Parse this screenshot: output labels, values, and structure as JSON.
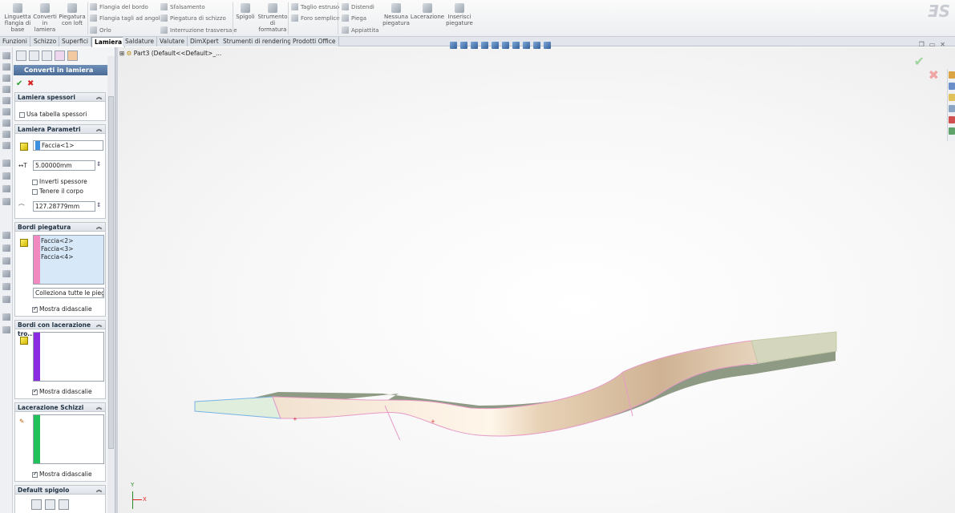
{
  "ribbon": {
    "tall_buttons": [
      {
        "name": "base-flange-tab-button",
        "label": "Linguetta flangia di base"
      },
      {
        "name": "convert-to-sheet-metal-button",
        "label": "Converti in lamiera"
      },
      {
        "name": "lofted-bend-button",
        "label": "Piegatura con loft"
      },
      {
        "name": "edges-button",
        "label": "Spigoli"
      },
      {
        "name": "forming-tool-button",
        "label": "Strumento di formatura"
      },
      {
        "name": "no-bends-button",
        "label": "Nessuna piegatura"
      },
      {
        "name": "rip-button",
        "label": "Lacerazione"
      },
      {
        "name": "insert-bends-button",
        "label": "Inserisci piegature"
      }
    ],
    "small_buttons": [
      {
        "name": "edge-flange-button",
        "label": "Flangia del bordo"
      },
      {
        "name": "miter-flange-button",
        "label": "Flangia tagli ad angolo"
      },
      {
        "name": "hem-button",
        "label": "Orlo"
      },
      {
        "name": "jog-button",
        "label": "Sfalsamento"
      },
      {
        "name": "sketched-bend-button",
        "label": "Piegatura di schizzo"
      },
      {
        "name": "cross-break-button",
        "label": "Interruzione trasversale"
      },
      {
        "name": "extruded-cut-button",
        "label": "Taglio estruso"
      },
      {
        "name": "simple-hole-button",
        "label": "Foro semplice"
      },
      {
        "name": "unfold-button",
        "label": "Distendi"
      },
      {
        "name": "fold-button",
        "label": "Piega"
      },
      {
        "name": "flatten-button",
        "label": "Appiattita"
      }
    ]
  },
  "tabs": [
    "Funzioni",
    "Schizzo",
    "Superfici",
    "Lamiera",
    "Saldature",
    "Valutare",
    "DimXpert",
    "Strumenti di rendering",
    "Prodotti Office"
  ],
  "active_tab": "Lamiera",
  "panel": {
    "title": "Converti in lamiera",
    "help": "?",
    "groups": {
      "gauges": {
        "title": "Lamiera spessori",
        "use_gauge_table": "Usa tabella spessori"
      },
      "parameters": {
        "title": "Lamiera Parametri",
        "fixed_face": "Faccia<1>",
        "thickness": "5.00000mm",
        "reverse_thickness": "Inverti spessore",
        "keep_body": "Tenere il corpo",
        "radius": "127.28779mm"
      },
      "bend_edges": {
        "title": "Bordi piegatura",
        "items": [
          "Faccia<2>",
          "Faccia<3>",
          "Faccia<4>"
        ],
        "collect_button": "Colleziona tutte le piegat",
        "show_callouts": "Mostra didascalie"
      },
      "rip_edges": {
        "title": "Bordi con lacerazione tro...",
        "show_callouts": "Mostra didascalie"
      },
      "rip_sketches": {
        "title": "Lacerazione Schizzi",
        "show_callouts": "Mostra didascalie"
      },
      "corner_default": {
        "title": "Default spigolo"
      }
    }
  },
  "viewport": {
    "tree_label": "Part3  (Default<<Default>_...",
    "triad_x": "X",
    "triad_y": "Y"
  },
  "colors": {
    "panel_title": "#5b7ca6",
    "face_fixed": "#3d8fe0",
    "face_bend": "#f08ac0",
    "face_rip": "#8a2be2",
    "face_sketch": "#22c05a",
    "confirm": "#2c9f2c",
    "cancel": "#d42020",
    "part_main": "#e3d0b8",
    "part_end": "#d2d5bf"
  }
}
